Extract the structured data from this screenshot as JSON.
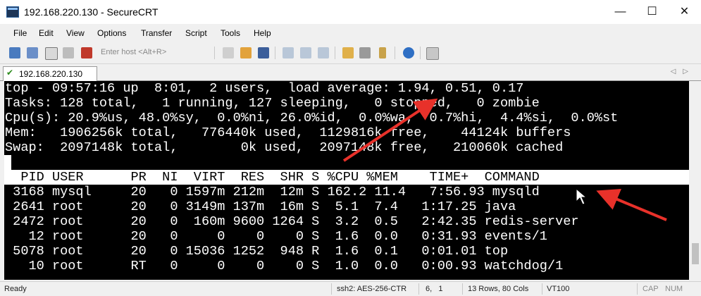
{
  "window": {
    "title": "192.168.220.130 - SecureCRT"
  },
  "window_controls": {
    "minimize": "—",
    "maximize": "☐",
    "close": "✕"
  },
  "menu": [
    "File",
    "Edit",
    "View",
    "Options",
    "Transfer",
    "Script",
    "Tools",
    "Help"
  ],
  "toolbar": {
    "host_placeholder": "Enter host <Alt+R>",
    "icons": [
      "connect-icon",
      "quick-connect-icon",
      "connect-in-tab-icon",
      "reconnect-icon",
      "disconnect-icon",
      "copy-icon",
      "paste-icon",
      "find-icon",
      "print-icon",
      "print-selection-icon",
      "print-setup-icon",
      "session-options-icon",
      "global-options-icon",
      "keymap-icon",
      "help-icon",
      "sftp-icon"
    ]
  },
  "tab": {
    "label": "192.168.220.130"
  },
  "terminal": {
    "lines": [
      "top - 09:57:16 up  8:01,  2 users,  load average: 1.94, 0.51, 0.17",
      "Tasks: 128 total,   1 running, 127 sleeping,   0 stopped,   0 zombie",
      "Cpu(s): 20.9%us, 48.0%sy,  0.0%ni, 26.0%id,  0.0%wa,  0.7%hi,  4.4%si,  0.0%st",
      "Mem:   1906256k total,   776440k used,  1129816k free,    44124k buffers",
      "Swap:  2097148k total,        0k used,  2097148k free,   210060k cached"
    ],
    "header": "  PID USER      PR  NI  VIRT  RES  SHR S %CPU %MEM    TIME+  COMMAND",
    "processes": [
      " 3168 mysql     20   0 1597m 212m  12m S 162.2 11.4   7:56.93 mysqld",
      " 2641 root      20   0 3149m 137m  16m S  5.1  7.4   1:17.25 java",
      " 2472 root      20   0  160m 9600 1264 S  3.2  0.5   2:42.35 redis-server",
      "   12 root      20   0     0    0    0 S  1.6  0.0   0:31.93 events/1",
      " 5078 root      20   0 15036 1252  948 R  1.6  0.1   0:01.01 top",
      "   10 root      RT   0     0    0    0 S  1.0  0.0   0:00.93 watchdog/1"
    ]
  },
  "status": {
    "state": "Ready",
    "protocol": "ssh2: AES-256-CTR",
    "position": "6,   1",
    "size": "13 Rows, 80 Cols",
    "emulation": "VT100",
    "caps": "CAP",
    "num": "NUM"
  },
  "colors": {
    "annotation_arrow": "#e8312a",
    "terminal_bg": "#000000",
    "terminal_fg": "#ffffff"
  }
}
